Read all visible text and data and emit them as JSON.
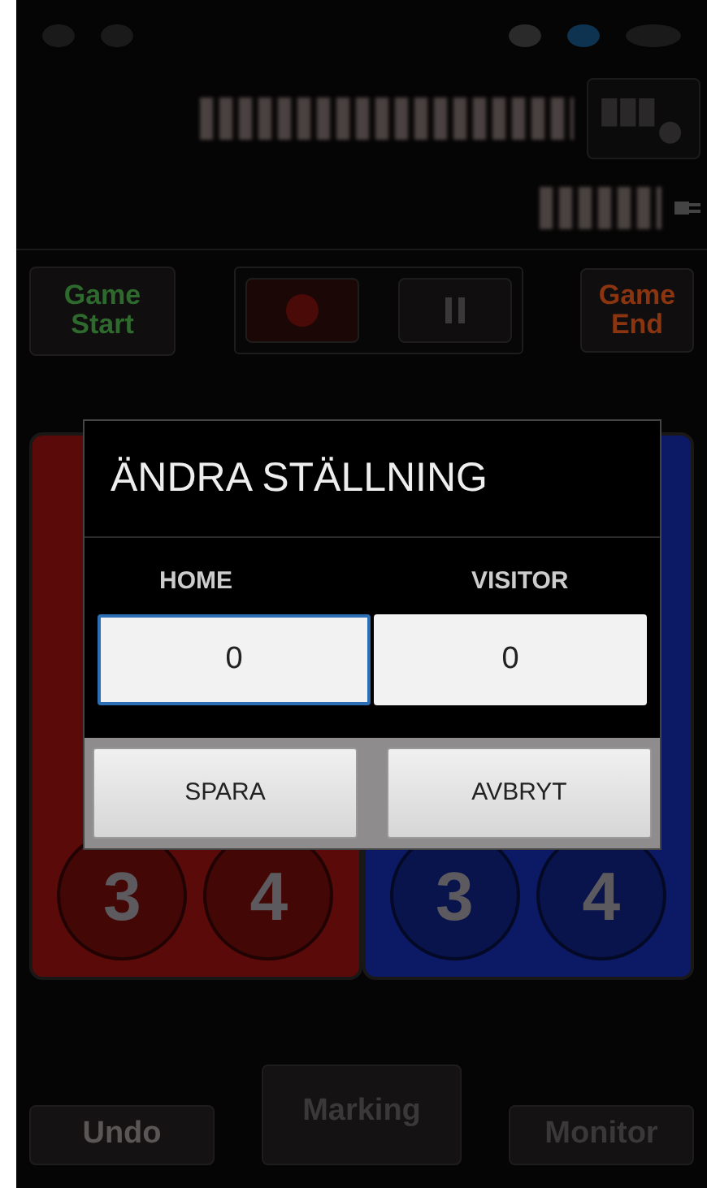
{
  "controls": [
    {
      "label": "Game Start",
      "kind": "start"
    },
    {
      "kind": "record"
    },
    {
      "kind": "pause"
    },
    {
      "label": "Game End",
      "kind": "end"
    }
  ],
  "teams": [
    {
      "color": "#5a0a08",
      "buttons": [
        "3",
        "4"
      ]
    },
    {
      "color": "#0c1a66",
      "buttons": [
        "3",
        "4"
      ]
    }
  ],
  "bottom_buttons": [
    "Undo",
    "Marking",
    "Monitor"
  ],
  "dialog": {
    "title": "ÄNDRA STÄLLNING",
    "fields": [
      {
        "label": "HOME",
        "value": "0",
        "focused": true
      },
      {
        "label": "VISITOR",
        "value": "0",
        "focused": false
      }
    ],
    "buttons": [
      "SPARA",
      "AVBRYT"
    ]
  }
}
